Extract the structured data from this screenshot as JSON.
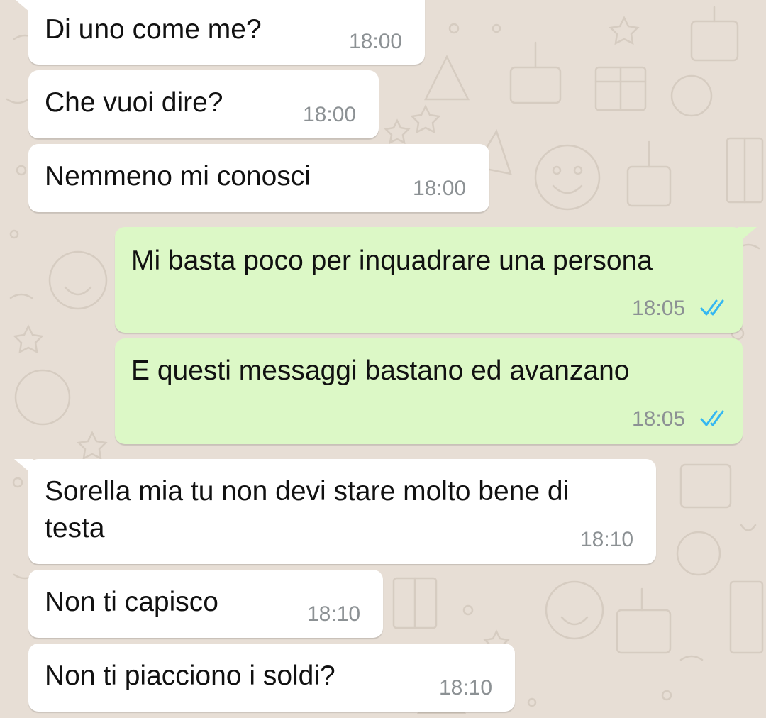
{
  "colors": {
    "wallpaper": "#e7ded5",
    "incoming_bubble": "#ffffff",
    "outgoing_bubble": "#dcf8c6",
    "read_ticks": "#34b7f1",
    "timestamp": "#8c9194"
  },
  "messages": [
    {
      "direction": "incoming",
      "text": "Di uno come me?",
      "time": "18:00"
    },
    {
      "direction": "incoming",
      "text": "Che vuoi dire?",
      "time": "18:00"
    },
    {
      "direction": "incoming",
      "text": "Nemmeno mi conosci",
      "time": "18:00"
    },
    {
      "direction": "outgoing",
      "text": "Mi basta poco per inquadrare una persona",
      "time": "18:05",
      "status_icon": "double-check-read-icon"
    },
    {
      "direction": "outgoing",
      "text": "E questi messaggi bastano ed avanzano",
      "time": "18:05",
      "status_icon": "double-check-read-icon"
    },
    {
      "direction": "incoming",
      "text_line1": "Sorella mia tu non devi stare molto bene di",
      "text_line2": "testa",
      "time": "18:10"
    },
    {
      "direction": "incoming",
      "text": "Non ti capisco",
      "time": "18:10"
    },
    {
      "direction": "incoming",
      "text": "Non ti piacciono i soldi?",
      "time": "18:10"
    }
  ]
}
